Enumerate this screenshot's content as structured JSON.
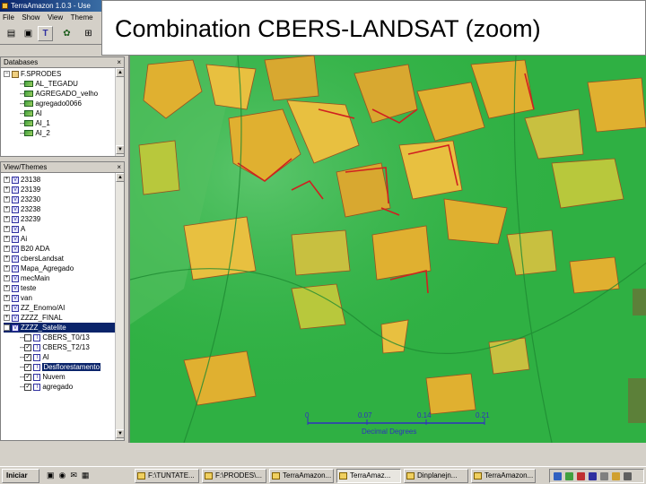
{
  "window": {
    "title": "TerraAmazon 1.0.3 - Use"
  },
  "menu": [
    "File",
    "Show",
    "View",
    "Theme"
  ],
  "slide": {
    "title": "Combination CBERS-LANDSAT (zoom)"
  },
  "databases_panel": {
    "title": "Databases",
    "items": [
      {
        "label": "F.SPRODES",
        "depth": 0,
        "kind": "database"
      },
      {
        "label": "AL_TEGADU",
        "depth": 1,
        "kind": "layer"
      },
      {
        "label": "AGREGADO_velho",
        "depth": 1,
        "kind": "layer"
      },
      {
        "label": "agregado0066",
        "depth": 1,
        "kind": "layer"
      },
      {
        "label": "AI",
        "depth": 1,
        "kind": "layer"
      },
      {
        "label": "AI_1",
        "depth": 1,
        "kind": "layer"
      },
      {
        "label": "AI_2",
        "depth": 1,
        "kind": "layer"
      }
    ]
  },
  "views_panel": {
    "title": "View/Themes",
    "items": [
      {
        "label": "23138",
        "kind": "view"
      },
      {
        "label": "23139",
        "kind": "view"
      },
      {
        "label": "23230",
        "kind": "view"
      },
      {
        "label": "23238",
        "kind": "view"
      },
      {
        "label": "23239",
        "kind": "view"
      },
      {
        "label": "A",
        "kind": "view"
      },
      {
        "label": "Ai",
        "kind": "view"
      },
      {
        "label": "B20 ADA",
        "kind": "view"
      },
      {
        "label": "cbersLandsat",
        "kind": "view"
      },
      {
        "label": "Mapa_Agregado",
        "kind": "view"
      },
      {
        "label": "mecMain",
        "kind": "view"
      },
      {
        "label": "teste",
        "kind": "view"
      },
      {
        "label": "van",
        "kind": "view"
      },
      {
        "label": "ZZ_Enomo/AI",
        "kind": "view"
      },
      {
        "label": "ZZZZ_FINAL",
        "kind": "view"
      },
      {
        "label": "ZZZZ_Satelite",
        "kind": "view",
        "selected": true
      },
      {
        "label": "CBERS_T0/13",
        "kind": "theme",
        "checked": false
      },
      {
        "label": "CBERS_T2/13",
        "kind": "theme",
        "checked": true
      },
      {
        "label": "AI",
        "kind": "theme",
        "checked": true
      },
      {
        "label": "Desflorestamento",
        "kind": "theme",
        "checked": true,
        "highlight": true
      },
      {
        "label": "Nuvem",
        "kind": "theme",
        "checked": true
      },
      {
        "label": "agregado",
        "kind": "theme",
        "checked": true
      }
    ]
  },
  "map": {
    "scale_ticks": [
      "0",
      "0.07",
      "0.14",
      "0.21"
    ],
    "scale_unit": "Decimal Degrees",
    "colors": {
      "forest": "#2fb043",
      "deforested": "#e0b030",
      "cerrado": "#b8c83c",
      "clear_cut_edge": "#d02020",
      "scale": "#3030c0"
    }
  },
  "taskbar": {
    "start_label": "Iniciar",
    "tasks": [
      "F:\\TUNTATE...",
      "F:\\PRODES\\...",
      "TerraAmazon...",
      "TerraAmaz...",
      "Dinplanejn...",
      "TerraAmazon..."
    ],
    "active_index": 3
  }
}
